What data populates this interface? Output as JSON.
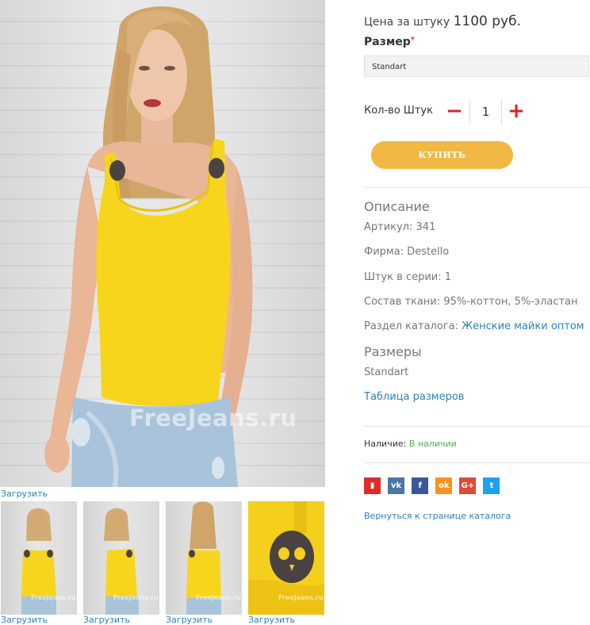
{
  "gallery": {
    "watermark": "FreeJeans.ru",
    "upload_label": "Загрузить",
    "thumbnails": [
      {
        "upload_label": "Загрузить"
      },
      {
        "upload_label": "Загрузить"
      },
      {
        "upload_label": "Загрузить"
      },
      {
        "upload_label": "Загрузить"
      }
    ],
    "thumb_watermark": "FreeJeans.ru"
  },
  "product": {
    "price_label": "Цена за штуку",
    "price_value": "1100 руб.",
    "size_label": "Размер",
    "size_required_mark": "*",
    "size_selected": "Standart",
    "qty_label": "Кол-во Штук",
    "qty_minus": "−",
    "qty_value": "1",
    "qty_plus": "+",
    "buy_label": "КУПИТЬ"
  },
  "description": {
    "title": "Описание",
    "article": "Артикул: 341",
    "brand": "Фирма: Destello",
    "series": "Штук в серии: 1",
    "fabric": "Состав ткани: 95%-коттон, 5%-эластан",
    "catalog_prefix": "Раздел каталога: ",
    "catalog_link": "Женские майки оптом"
  },
  "sizes": {
    "title": "Размеры",
    "value": "Standart",
    "table_link": "Таблица размеров"
  },
  "availability": {
    "label": "Наличие:",
    "value": "В наличии"
  },
  "share": [
    {
      "icon": "bookmark-icon",
      "glyph": "▮",
      "color": "#e02b2b"
    },
    {
      "icon": "vk-icon",
      "glyph": "vk",
      "color": "#4a76a8"
    },
    {
      "icon": "facebook-icon",
      "glyph": "f",
      "color": "#3b5998"
    },
    {
      "icon": "odnoklassniki-icon",
      "glyph": "ok",
      "color": "#f7931e"
    },
    {
      "icon": "google-plus-icon",
      "glyph": "G+",
      "color": "#dd4b39"
    },
    {
      "icon": "twitter-icon",
      "glyph": "t",
      "color": "#1da1f2"
    }
  ],
  "back_link": "Вернуться к странице каталога",
  "colors": {
    "accent_button": "#f2b844",
    "link": "#2b80c0",
    "qty_controls": "#e02020",
    "in_stock": "#4caf50",
    "top_color": "#f7d51d"
  }
}
